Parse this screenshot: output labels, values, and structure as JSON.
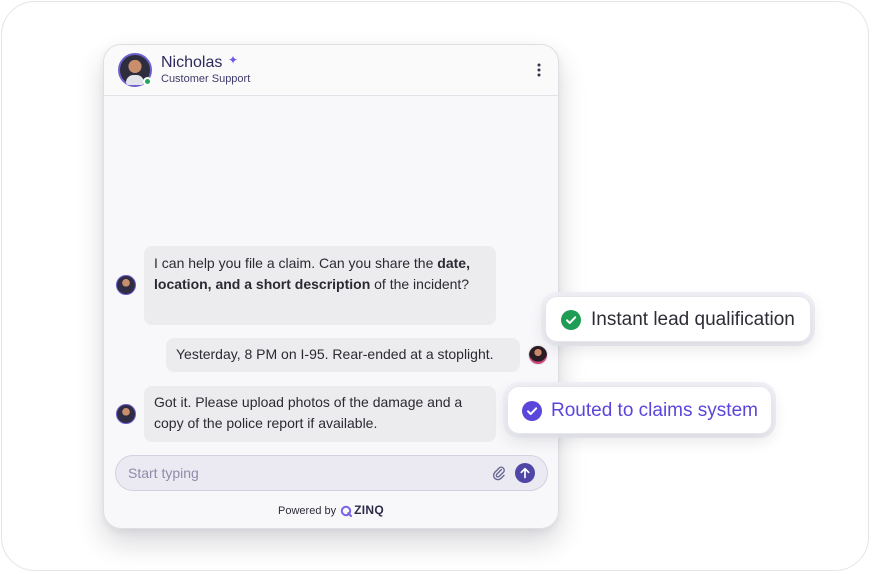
{
  "agent": {
    "name": "Nicholas",
    "role": "Customer Support",
    "status": "online"
  },
  "messages": [
    {
      "sender": "agent",
      "text_before": "I can help you file a claim. Can you share the ",
      "text_bold": "date, location, and a short description",
      "text_after": " of the incident?"
    },
    {
      "sender": "user",
      "text": "Yesterday, 8 PM on I-95. Rear-ended at a stoplight."
    },
    {
      "sender": "agent",
      "text": "Got it. Please upload photos of the damage and a copy of the police report if available."
    }
  ],
  "composer": {
    "placeholder": "Start typing",
    "value": ""
  },
  "footer": {
    "powered_by": "Powered by",
    "brand": "ZINQ"
  },
  "badges": [
    {
      "label": "Instant lead qualification",
      "color": "#1f9d55"
    },
    {
      "label": "Routed to claims system",
      "color": "#5b46dc"
    }
  ],
  "icons": {
    "sparkle": "sparkle-icon",
    "menu": "kebab-menu-icon",
    "attach": "paperclip-icon",
    "send": "arrow-up-icon",
    "check": "check-circle-icon"
  },
  "colors": {
    "accent": "#4f46a6",
    "badge_purple": "#5b46dc",
    "badge_green": "#1f9d55",
    "online": "#22a55a"
  }
}
